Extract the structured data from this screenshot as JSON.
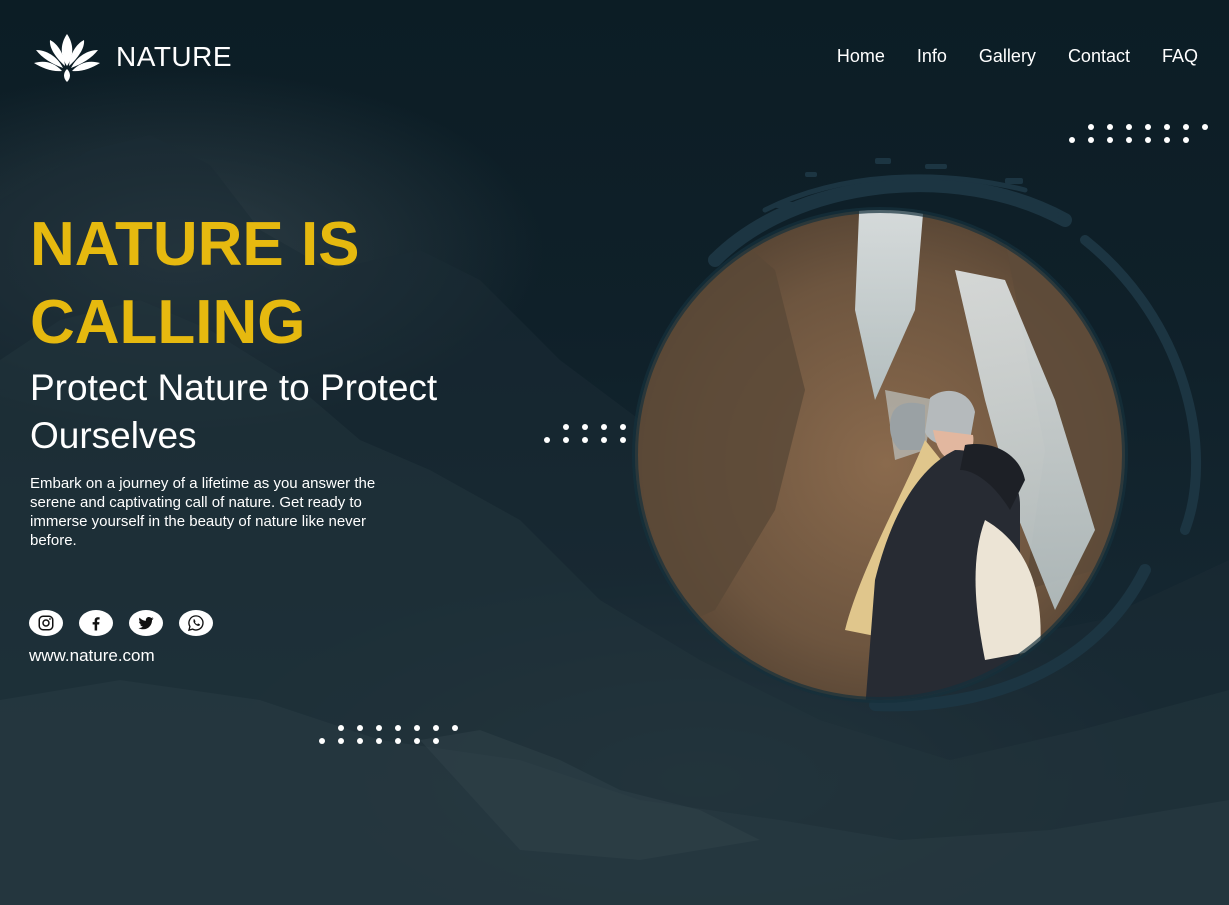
{
  "brand": {
    "name": "NATURE",
    "logo_icon": "lotus-icon"
  },
  "nav": {
    "items": [
      "Home",
      "Info",
      "Gallery",
      "Contact",
      "FAQ"
    ]
  },
  "hero": {
    "title": "NATURE IS CALLING",
    "subtitle": "Protect Nature to Protect Ourselves",
    "description": "Embark on a journey of a lifetime as you answer the serene and captivating call of nature. Get ready to immerse yourself in the beauty of nature like never before."
  },
  "social": {
    "icons": [
      "instagram-icon",
      "facebook-icon",
      "twitter-icon",
      "whatsapp-icon"
    ],
    "website": "www.nature.com"
  },
  "colors": {
    "accent": "#e6b90f",
    "background": "#0f1f28",
    "text": "#ffffff"
  }
}
